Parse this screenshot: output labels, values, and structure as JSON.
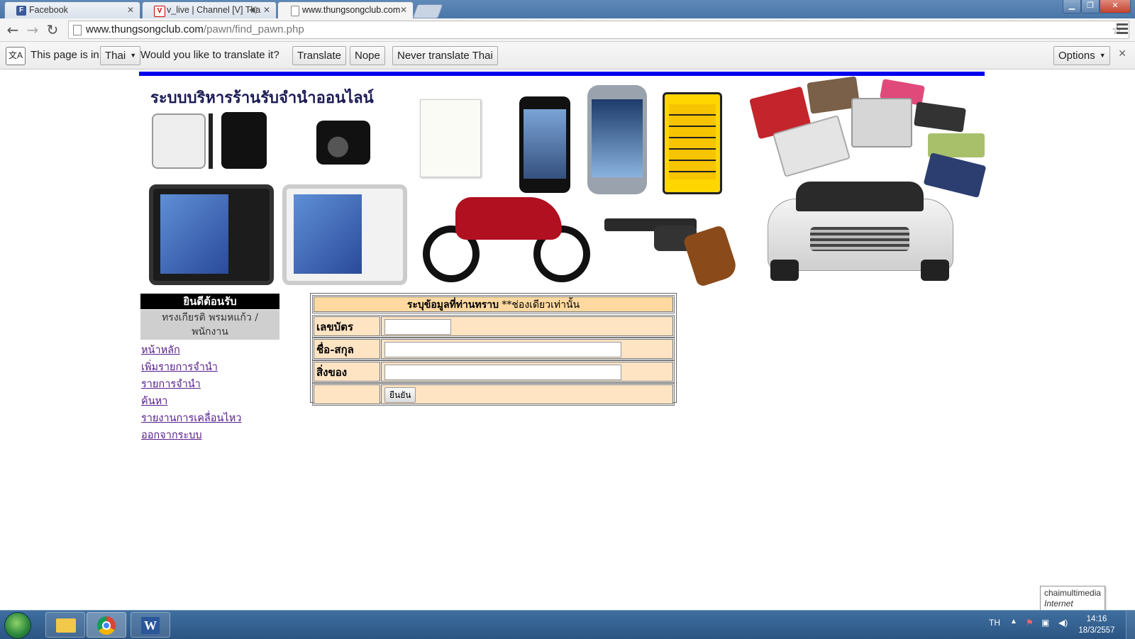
{
  "browser": {
    "tabs": [
      {
        "title": "Facebook",
        "favicon": "F",
        "favicon_color": "#3b5998"
      },
      {
        "title": "v_live | Channel [V] Tha",
        "favicon": "V",
        "favicon_color": "#cc0000",
        "audio": true
      },
      {
        "title": "www.thungsongclub.com",
        "favicon": "",
        "favicon_color": "#ffffff",
        "active": true
      }
    ],
    "url_host": "www.thungsongclub.com",
    "url_path": "/pawn/find_pawn.php"
  },
  "translate_bar": {
    "prefix": "This page is in",
    "language": "Thai",
    "question": "Would you like to translate it?",
    "translate": "Translate",
    "nope": "Nope",
    "never": "Never translate Thai",
    "options": "Options"
  },
  "page": {
    "banner_title": "ระบบบริหารร้านรับจำนำออนไลน์",
    "sidebar": {
      "welcome": "ยินดีต้อนรับ",
      "user_line1": "ทรงเกียรติ พรมหแก้ว /",
      "user_line2": "พนักงาน",
      "links": [
        "หน้าหลัก",
        "เพิ่มรายการจำนำ",
        "รายการจำนำ",
        "ค้นหา",
        "รายงานการเคลื่อนไหว",
        "ออกจากระบบ"
      ]
    },
    "form": {
      "header_bold": "ระบุข้อมูลที่ท่านทราบ",
      "header_rest": " **ช่องเดียวเท่านั้น",
      "card_label": "เลขบัตร",
      "name_label": "ชื่อ-สกุล",
      "item_label": "สิ่งของ",
      "card_value": "",
      "name_value": "",
      "item_value": "",
      "submit": "ยืนยัน"
    }
  },
  "taskbar": {
    "lang": "TH",
    "time": "14:16",
    "date": "18/3/2557",
    "tooltip_title": "chaimultimedia",
    "tooltip_sub": "Internet access"
  }
}
